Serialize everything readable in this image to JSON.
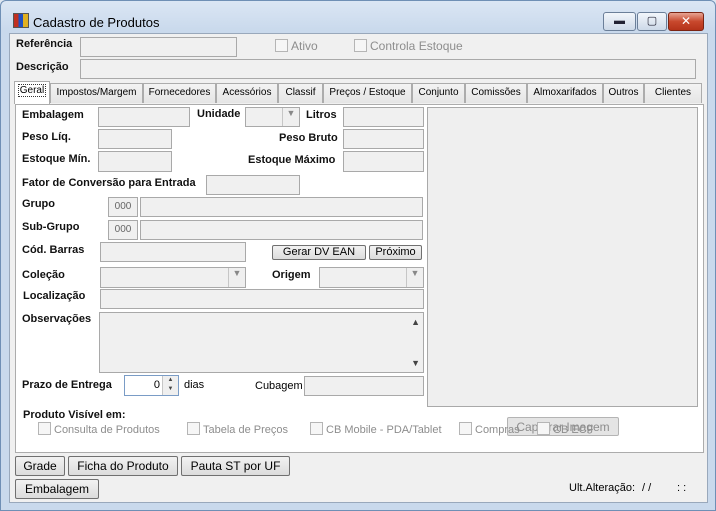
{
  "window": {
    "title": "Cadastro de Produtos",
    "min_label": "▬",
    "max_label": "▢",
    "close_label": "✕"
  },
  "header": {
    "referencia_label": "Referência",
    "ativo_label": "Ativo",
    "controla_estoque_label": "Controla Estoque",
    "descricao_label": "Descrição"
  },
  "tabs": [
    {
      "label": "Geral"
    },
    {
      "label": "Impostos/Margem"
    },
    {
      "label": "Fornecedores"
    },
    {
      "label": "Acessórios"
    },
    {
      "label": "Classif"
    },
    {
      "label": "Preços / Estoque"
    },
    {
      "label": "Conjunto"
    },
    {
      "label": "Comissões"
    },
    {
      "label": "Almoxarifados"
    },
    {
      "label": "Outros"
    },
    {
      "label": "Clientes"
    }
  ],
  "geral": {
    "embalagem_label": "Embalagem",
    "unidade_label": "Unidade",
    "litros_label": "Litros",
    "peso_liq_label": "Peso Líq.",
    "peso_bruto_label": "Peso Bruto",
    "estoque_min_label": "Estoque Mín.",
    "estoque_max_label": "Estoque Máximo",
    "fator_label": "Fator de Conversão para Entrada",
    "grupo_label": "Grupo",
    "grupo_code": "000",
    "subgrupo_label": "Sub-Grupo",
    "subgrupo_code": "000",
    "cod_barras_label": "Cód. Barras",
    "gerar_dv_label": "Gerar DV EAN",
    "proximo_label": "Próximo",
    "colecao_label": "Coleção",
    "origem_label": "Origem",
    "localizacao_label": "Localização",
    "observacoes_label": "Observações",
    "prazo_label": "Prazo de Entrega",
    "prazo_value": "0",
    "dias_label": "dias",
    "cubagem_label": "Cubagem",
    "capturar_label": "Capturar Imagem"
  },
  "visivel": {
    "label": "Produto Visível em:",
    "options": [
      {
        "label": "Consulta de Produtos"
      },
      {
        "label": "Tabela de Preços"
      },
      {
        "label": "CB Mobile - PDA/Tablet"
      },
      {
        "label": "Compras"
      },
      {
        "label": "CB ECF"
      }
    ]
  },
  "buttons": {
    "grade": "Grade",
    "ficha": "Ficha do Produto",
    "pauta": "Pauta ST por UF",
    "embalagem": "Embalagem"
  },
  "status": {
    "ult_alteracao_label": "Ult.Alteração:",
    "date_value": "/ /",
    "time_value": ": :"
  }
}
